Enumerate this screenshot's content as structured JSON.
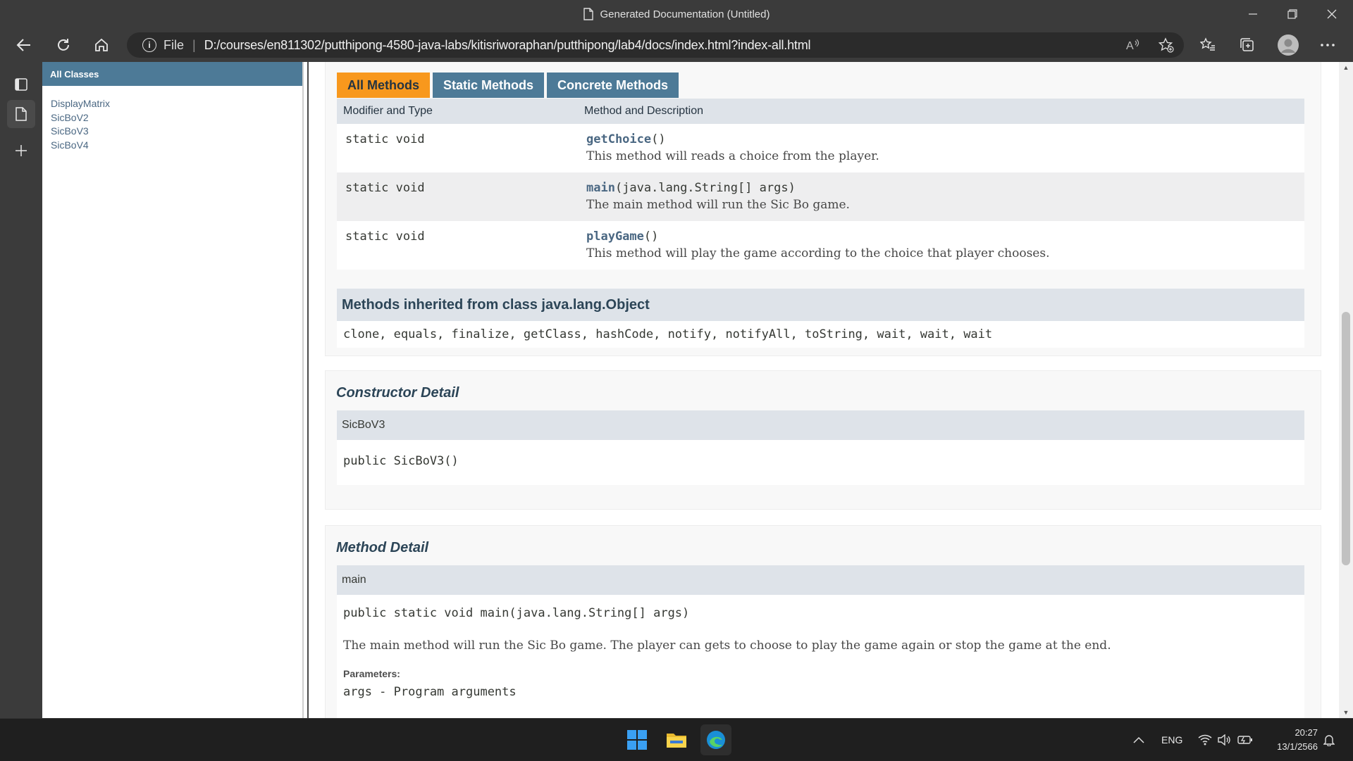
{
  "window": {
    "title": "Generated Documentation (Untitled)"
  },
  "toolbar": {
    "file_label": "File",
    "url": "D:/courses/en811302/putthipong-4580-java-labs/kitisriworaphan/putthipong/lab4/docs/index.html?index-all.html"
  },
  "left_frame": {
    "header": "All Classes",
    "classes": [
      "DisplayMatrix",
      "SicBoV2",
      "SicBoV3",
      "SicBoV4"
    ]
  },
  "method_summary": {
    "tabs": [
      "All Methods",
      "Static Methods",
      "Concrete Methods"
    ],
    "columns": [
      "Modifier and Type",
      "Method and Description"
    ],
    "rows": [
      {
        "modifier": "static void",
        "name": "getChoice",
        "params": "()",
        "description": "This method will reads a choice from the player."
      },
      {
        "modifier": "static void",
        "name": "main",
        "params": "(java.lang.String[] args)",
        "description": "The main method will run the Sic Bo game."
      },
      {
        "modifier": "static void",
        "name": "playGame",
        "params": "()",
        "description": "This method will play the game according to the choice that player chooses."
      }
    ],
    "inherited_title": "Methods inherited from class java.lang.Object",
    "inherited_methods": "clone, equals, finalize, getClass, hashCode, notify, notifyAll, toString, wait, wait, wait"
  },
  "constructor_detail": {
    "title": "Constructor Detail",
    "name": "SicBoV3",
    "signature": "public SicBoV3()"
  },
  "method_detail": {
    "title": "Method Detail",
    "name": "main",
    "signature": "public static void main(java.lang.String[] args)",
    "description": "The main method will run the Sic Bo game. The player can gets to choose to play the game again or stop the game at the end.",
    "params_label": "Parameters:",
    "param": "args - Program arguments"
  },
  "taskbar": {
    "language": "ENG",
    "time": "20:27",
    "date": "13/1/2566"
  },
  "colors": {
    "javadoc_blue": "#4d7a97",
    "javadoc_orange": "#f8981d",
    "header_bg": "#dee3e9",
    "browser_chrome": "#3b3b3b"
  }
}
